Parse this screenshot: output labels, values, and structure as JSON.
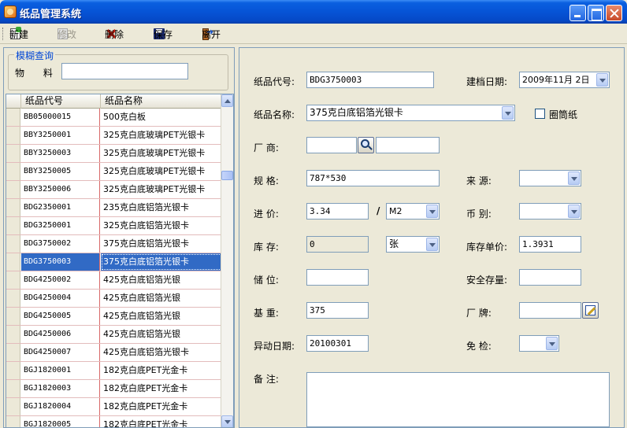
{
  "window": {
    "title": "纸品管理系统"
  },
  "toolbar": {
    "new_label": "新建",
    "edit_label": "修改",
    "delete_label": "删除",
    "save_label": "保存",
    "exit_label": "离开"
  },
  "fuzzy_search": {
    "legend": "模糊查询",
    "material_label": "物  料:",
    "material_value": ""
  },
  "grid": {
    "columns": [
      "纸品代号",
      "纸品名称"
    ],
    "rows": [
      {
        "code": "BB05000015",
        "name": "500克白板"
      },
      {
        "code": "BBY3250001",
        "name": "325克白底玻璃PET光银卡"
      },
      {
        "code": "BBY3250003",
        "name": "325克白底玻璃PET光银卡"
      },
      {
        "code": "BBY3250005",
        "name": "325克白底玻璃PET光银卡"
      },
      {
        "code": "BBY3250006",
        "name": "325克白底玻璃PET光银卡"
      },
      {
        "code": "BDG2350001",
        "name": "235克白底铝箔光银卡"
      },
      {
        "code": "BDG3250001",
        "name": "325克白底铝箔光银卡"
      },
      {
        "code": "BDG3750002",
        "name": "375克白底铝箔光银卡"
      },
      {
        "code": "BDG3750003",
        "name": "375克白底铝箔光银卡"
      },
      {
        "code": "BDG4250002",
        "name": "425克白底铝箔光银"
      },
      {
        "code": "BDG4250004",
        "name": "425克白底铝箔光银"
      },
      {
        "code": "BDG4250005",
        "name": "425克白底铝箔光银"
      },
      {
        "code": "BDG4250006",
        "name": "425克白底铝箔光银"
      },
      {
        "code": "BDG4250007",
        "name": "425克白底铝箔光银卡"
      },
      {
        "code": "BGJ1820001",
        "name": "182克白底PET光金卡"
      },
      {
        "code": "BGJ1820003",
        "name": "182克白底PET光金卡"
      },
      {
        "code": "BGJ1820004",
        "name": "182克白底PET光金卡"
      },
      {
        "code": "BGJ1820005",
        "name": "182克白底PET光金卡"
      }
    ],
    "selected_index": 8
  },
  "form": {
    "code_label": "纸品代号:",
    "code_value": "BDG3750003",
    "date_label": "建档日期:",
    "date_value": "2009年11月 2日",
    "name_label": "纸品名称:",
    "name_value": "375克白底铝箔光银卡",
    "tube_label": "圈筒纸",
    "tube_checked": false,
    "vendor_label": "厂    商:",
    "vendor_code": "",
    "vendor_name": "",
    "spec_label": "规    格:",
    "spec_value": "787*530",
    "source_label": "来    源:",
    "source_value": "",
    "price_label": "进    价:",
    "price_value": "3.34",
    "price_slash": "/",
    "price_unit": "M2",
    "currency_label": "币    别:",
    "currency_value": "",
    "stock_label": "库    存:",
    "stock_value": "0",
    "stock_unit": "张",
    "stock_price_label": "库存单价:",
    "stock_price_value": "1.3931",
    "location_label": "储    位:",
    "location_value": "",
    "safety_label": "安全存量:",
    "safety_value": "",
    "basis_label": "基    重:",
    "basis_value": "375",
    "brand_label": "厂    牌:",
    "brand_value": "",
    "change_date_label": "异动日期:",
    "change_date_value": "20100301",
    "exempt_label": "免    检:",
    "exempt_value": "",
    "remark_label": "备    注:",
    "remark_value": ""
  }
}
